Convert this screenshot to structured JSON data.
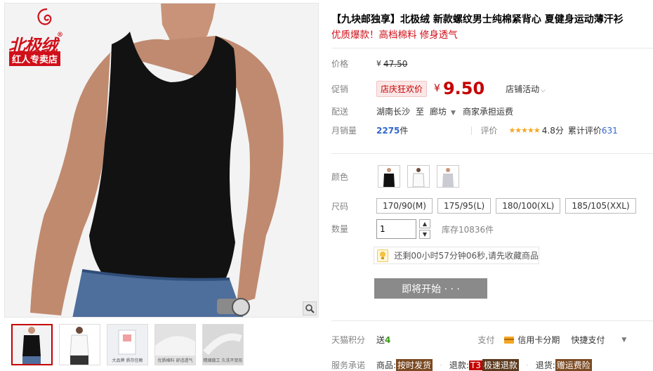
{
  "brand": {
    "name": "北极绒",
    "reg": "®",
    "shop": "红人专卖店"
  },
  "title": "【九块邮独享】北极绒 新款螺纹男士纯棉紧背心 夏健身运动薄汗衫",
  "subtitle": "优质爆款！高档棉料 修身透气",
  "price": {
    "label": "价格",
    "currency": "¥",
    "original": "47.50"
  },
  "promo": {
    "label": "促销",
    "tag": "店庆狂欢价",
    "currency": "¥",
    "price": "9.50",
    "shop_activity": "店铺活动"
  },
  "delivery": {
    "label": "配送",
    "from": "湖南长沙",
    "to_word": "至",
    "to": "廊坊",
    "freight": "商家承担运费"
  },
  "sales": {
    "label": "月销量",
    "count": "2275",
    "unit": "件",
    "rating_label": "评价",
    "stars": "★★★★★",
    "score": "4.8分",
    "total_label": "累计评价",
    "total": "631"
  },
  "color": {
    "label": "颜色",
    "options": [
      "#111111",
      "#ffffff",
      "#d8dbe0"
    ]
  },
  "size": {
    "label": "尺码",
    "options": [
      "170/90(M)",
      "175/95(L)",
      "180/100(XL)",
      "185/105(XXL)"
    ]
  },
  "quantity": {
    "label": "数量",
    "value": "1",
    "stock": "库存10836件"
  },
  "tip": {
    "text": "还剩00小时57分钟06秒,请先收藏商品"
  },
  "start_button": {
    "label": "即将开始 · · ·"
  },
  "points": {
    "label": "天猫积分",
    "send": "送",
    "value": "4",
    "pay_label": "支付",
    "credit": "信用卡分期",
    "quick_pay": "快捷支付"
  },
  "service": {
    "label": "服务承诺",
    "goods": "商品:",
    "goods_tag": "按时发货",
    "refund": "退款:",
    "refund_tag1": "T3",
    "refund_tag2": "极速退款",
    "return": "退货:",
    "return_tag": "赠运费险"
  },
  "thumbs": {
    "caption3": "大品牌 质存信赖",
    "caption4": "优质棉料 舒适透气",
    "caption5": "精细做工 久洗不变形"
  },
  "colors": {
    "accent": "#c40000",
    "brand": "#d0101a",
    "button": "#8a8a8a"
  }
}
